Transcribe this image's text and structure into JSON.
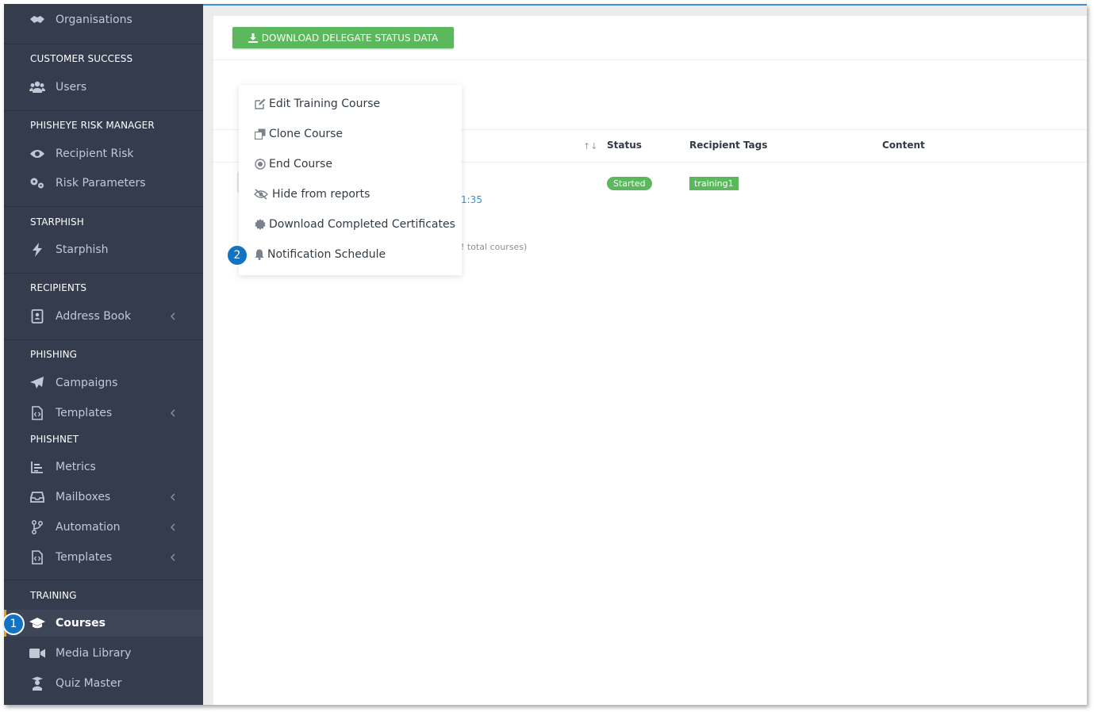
{
  "sidebar": {
    "items": {
      "organisations": "Organisations",
      "users": "Users",
      "recipient_risk": "Recipient Risk",
      "risk_parameters": "Risk Parameters",
      "starphish": "Starphish",
      "address_book": "Address Book",
      "campaigns": "Campaigns",
      "phishing_templates": "Templates",
      "metrics": "Metrics",
      "mailboxes": "Mailboxes",
      "automation": "Automation",
      "phishnet_templates": "Templates",
      "courses": "Courses",
      "media_library": "Media Library",
      "quiz_master": "Quiz Master"
    },
    "sections": {
      "customer_success": "CUSTOMER SUCCESS",
      "phisheye": "PHISHEYE RISK MANAGER",
      "starphish": "STARPHISH",
      "recipients": "RECIPIENTS",
      "phishing": "PHISHING",
      "phishnet": "PHISHNET",
      "training": "TRAINING"
    },
    "active_item": "Courses"
  },
  "steps": {
    "one": "1",
    "two": "2"
  },
  "main": {
    "download_button": "DOWNLOAD DELEGATE STATUS DATA",
    "table": {
      "headers": {
        "status": "Status",
        "recipient_tags": "Recipient Tags",
        "content": "Content"
      },
      "row": {
        "status": "Started",
        "tag": "training1",
        "time_fragment": "1:35"
      },
      "footer_fragment": "! total courses)"
    }
  },
  "dropdown": {
    "items": {
      "edit": "Edit Training Course",
      "clone": "Clone Course",
      "end": "End Course",
      "hide": "Hide from reports",
      "download_certs": "Download Completed Certificates",
      "notification": "Notification Schedule"
    }
  },
  "colors": {
    "sidebar_bg": "#353c4e",
    "accent_green": "#5cb85c",
    "step_badge": "#1372c2",
    "active_marker": "#f39c12",
    "link_blue": "#3a8fd6"
  }
}
